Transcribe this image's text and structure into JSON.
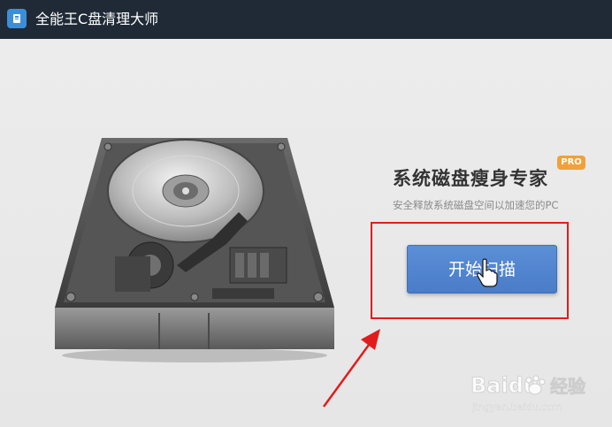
{
  "window": {
    "title": "全能王C盘清理大师"
  },
  "hero": {
    "headline": "系统磁盘瘦身专家",
    "badge": "PRO",
    "subtitle": "安全释放系统磁盘空间以加速您的PC"
  },
  "actions": {
    "scan_label": "开始扫描"
  },
  "watermark": {
    "brand": "Baidu",
    "suffix": "经验",
    "url": "jingyan.baidu.com"
  },
  "colors": {
    "titlebar": "#1f2a36",
    "button": "#4a7cc8",
    "highlight": "#e01d1d",
    "badge": "#f0a13a"
  }
}
